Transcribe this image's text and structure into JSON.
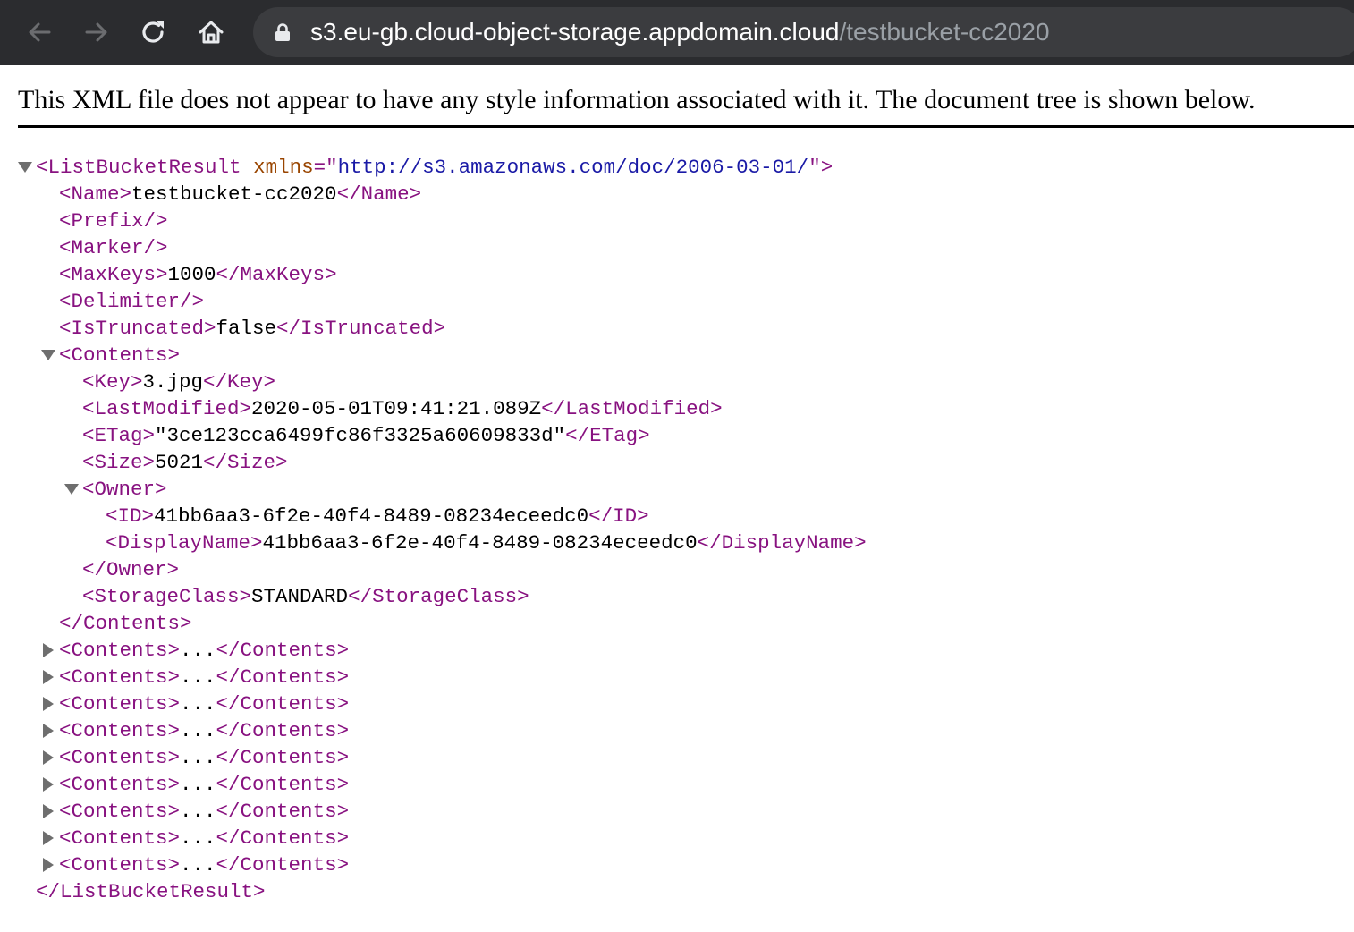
{
  "browser": {
    "url_host": "s3.eu-gb.cloud-object-storage.appdomain.cloud",
    "url_path": "/testbucket-cc2020",
    "icons": [
      "back-arrow-icon",
      "forward-arrow-icon",
      "reload-icon",
      "home-icon",
      "lock-icon"
    ]
  },
  "viewer": {
    "notice": "This XML file does not appear to have any style information associated with it. The document tree is shown below."
  },
  "xml": {
    "root_open": "<ListBucketResult",
    "root_attr_name": "xmlns",
    "root_attr_eq": "=\"",
    "root_attr_value": "http://s3.amazonaws.com/doc/2006-03-01/",
    "root_attr_close": "\">",
    "name_open": "<Name>",
    "name_value": "testbucket-cc2020",
    "name_close": "</Name>",
    "prefix": "<Prefix/>",
    "marker": "<Marker/>",
    "maxkeys_open": "<MaxKeys>",
    "maxkeys_value": "1000",
    "maxkeys_close": "</MaxKeys>",
    "delimiter": "<Delimiter/>",
    "istruncated_open": "<IsTruncated>",
    "istruncated_value": "false",
    "istruncated_close": "</IsTruncated>",
    "contents_open": "<Contents>",
    "key_open": "<Key>",
    "key_value": "3.jpg",
    "key_close": "</Key>",
    "lastmod_open": "<LastModified>",
    "lastmod_value": "2020-05-01T09:41:21.089Z",
    "lastmod_close": "</LastModified>",
    "etag_open": "<ETag>",
    "etag_value": "\"3ce123cca6499fc86f3325a60609833d\"",
    "etag_close": "</ETag>",
    "size_open": "<Size>",
    "size_value": "5021",
    "size_close": "</Size>",
    "owner_open": "<Owner>",
    "id_open": "<ID>",
    "id_value": "41bb6aa3-6f2e-40f4-8489-08234eceedc0",
    "id_close": "</ID>",
    "display_open": "<DisplayName>",
    "display_value": "41bb6aa3-6f2e-40f4-8489-08234eceedc0",
    "display_close": "</DisplayName>",
    "owner_close": "</Owner>",
    "storage_open": "<StorageClass>",
    "storage_value": "STANDARD",
    "storage_close": "</StorageClass>",
    "contents_close": "</Contents>",
    "collapsed_open": "<Contents>",
    "collapsed_ellipsis": "...",
    "collapsed_close": "</Contents>",
    "collapsed_count": 9,
    "root_close": "</ListBucketResult>"
  }
}
